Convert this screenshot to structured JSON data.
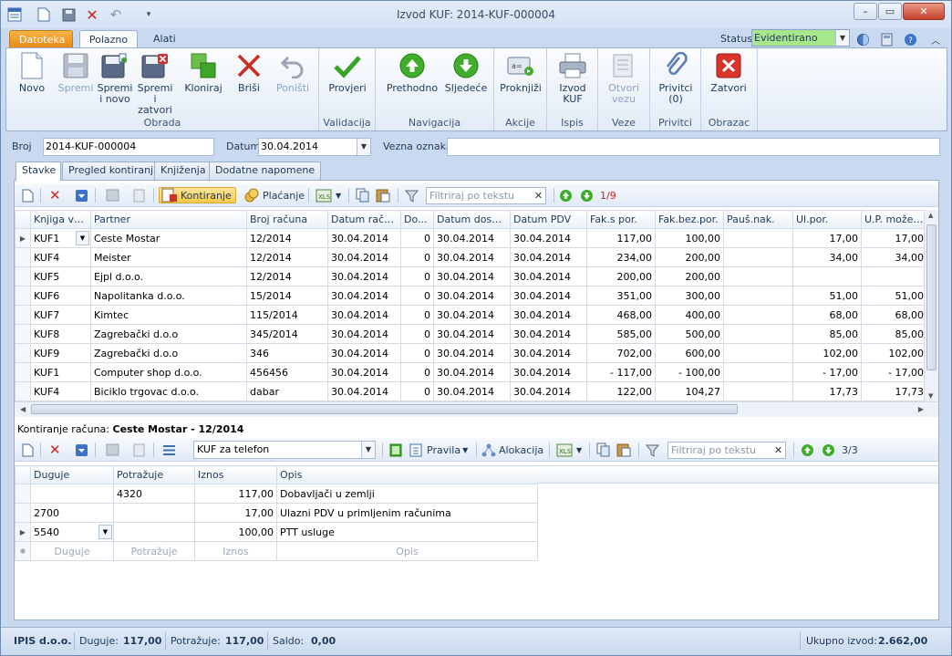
{
  "window": {
    "title": "Izvod KUF: 2014-KUF-000004"
  },
  "ribbon_tabs": [
    "Datoteka",
    "Polazno",
    "Alati"
  ],
  "status": {
    "label": "Status",
    "value": "Evidentirano"
  },
  "ribbon": {
    "groups": {
      "obrada": "Obrada",
      "validacija": "Validacija",
      "navigacija": "Navigacija",
      "akcije": "Akcije",
      "ispis": "Ispis",
      "veze": "Veze",
      "privitci": "Privitci",
      "obrazac": "Obrazac"
    },
    "buttons": {
      "novo": "Novo",
      "spremi": "Spremi",
      "spremi_novo_1": "Spremi",
      "spremi_novo_2": "i novo",
      "spremi_zatvori_1": "Spremi i",
      "spremi_zatvori_2": "zatvori",
      "kloniraj": "Kloniraj",
      "brisi": "Briši",
      "ponisti": "Poništi",
      "provjeri": "Provjeri",
      "prethodno": "Prethodno",
      "sljedece": "Sljedeće",
      "proknjizi": "Proknjiži",
      "izvod_1": "Izvod",
      "izvod_2": "KUF",
      "otvori_1": "Otvori",
      "otvori_2": "vezu",
      "privitci_1": "Privitci",
      "privitci_2": "(0)",
      "zatvori": "Zatvori"
    }
  },
  "header_fields": {
    "broj_label": "Broj",
    "broj_value": "2014-KUF-000004",
    "datum_label": "Datum",
    "datum_value": "30.04.2014",
    "vezna_label": "Vezna oznaka",
    "vezna_value": ""
  },
  "doc_tabs": [
    "Stavke",
    "Pregled kontiranja",
    "Knjiženja",
    "Dodatne napomene"
  ],
  "top_toolbar": {
    "kontiranje": "Kontiranje",
    "placanje": "Plaćanje",
    "filter_placeholder": "Filtriraj po tekstu",
    "pager": "1/9"
  },
  "stavke_table": {
    "columns": [
      "Knjiga vrsta",
      "Partner",
      "Broj računa",
      "Datum računa",
      "Do...",
      "Datum dospij...",
      "Datum PDV",
      "Fak.s por.",
      "Fak.bez.por.",
      "Pauš.nak.",
      "Ul.por.",
      "U.P. može ..."
    ],
    "rows": [
      [
        "KUF1",
        "Ceste Mostar",
        "12/2014",
        "30.04.2014",
        "0",
        "30.04.2014",
        "30.04.2014",
        "117,00",
        "100,00",
        "",
        "17,00",
        "17,00"
      ],
      [
        "KUF4",
        "Meister",
        "12/2014",
        "30.04.2014",
        "0",
        "30.04.2014",
        "30.04.2014",
        "234,00",
        "200,00",
        "",
        "34,00",
        "34,00"
      ],
      [
        "KUF5",
        "Ejpl d.o.o.",
        "12/2014",
        "30.04.2014",
        "0",
        "30.04.2014",
        "30.04.2014",
        "200,00",
        "200,00",
        "",
        "",
        ""
      ],
      [
        "KUF6",
        "Napolitanka d.o.o.",
        "15/2014",
        "30.04.2014",
        "0",
        "30.04.2014",
        "30.04.2014",
        "351,00",
        "300,00",
        "",
        "51,00",
        "51,00"
      ],
      [
        "KUF7",
        "Kimtec",
        "115/2014",
        "30.04.2014",
        "0",
        "30.04.2014",
        "30.04.2014",
        "468,00",
        "400,00",
        "",
        "68,00",
        "68,00"
      ],
      [
        "KUF8",
        "Zagrebački d.o.o",
        "345/2014",
        "30.04.2014",
        "0",
        "30.04.2014",
        "30.04.2014",
        "585,00",
        "500,00",
        "",
        "85,00",
        "85,00"
      ],
      [
        "KUF9",
        "Zagrebački d.o.o",
        "346",
        "30.04.2014",
        "0",
        "30.04.2014",
        "30.04.2014",
        "702,00",
        "600,00",
        "",
        "102,00",
        "102,00"
      ],
      [
        "KUF1",
        "Computer shop d.o.o.",
        "456456",
        "30.04.2014",
        "0",
        "30.04.2014",
        "30.04.2014",
        "- 117,00",
        "- 100,00",
        "",
        "- 17,00",
        "- 17,00"
      ],
      [
        "KUF4",
        "Biciklo trgovac d.o.o.",
        "dabar",
        "30.04.2014",
        "0",
        "30.04.2014",
        "30.04.2014",
        "122,00",
        "104,27",
        "",
        "17,73",
        "17,73"
      ]
    ]
  },
  "kontiranje": {
    "label": "Kontiranje računa:",
    "value": "Ceste Mostar - 12/2014",
    "template": "KUF za telefon",
    "pravila": "Pravila",
    "alokacija": "Alokacija",
    "filter_placeholder": "Filtriraj po tekstu",
    "pager": "3/3",
    "columns": [
      "Duguje",
      "Potražuje",
      "Iznos",
      "Opis"
    ],
    "rows": [
      [
        "",
        "4320",
        "117,00",
        "Dobavljači u zemlji"
      ],
      [
        "2700",
        "",
        "17,00",
        "Ulazni PDV u primljenim računima"
      ],
      [
        "5540",
        "",
        "100,00",
        "PTT usluge"
      ]
    ],
    "new_row": [
      "Duguje",
      "Potražuje",
      "Iznos",
      "Opis"
    ]
  },
  "statusbar": {
    "company": "IPIS d.o.o.",
    "duguje_label": "Duguje:",
    "duguje_value": "117,00",
    "potrazuje_label": "Potražuje:",
    "potrazuje_value": "117,00",
    "saldo_label": "Saldo:",
    "saldo_value": "0,00",
    "ukupno_label": "Ukupno izvod:",
    "ukupno_value": "2.662,00"
  }
}
